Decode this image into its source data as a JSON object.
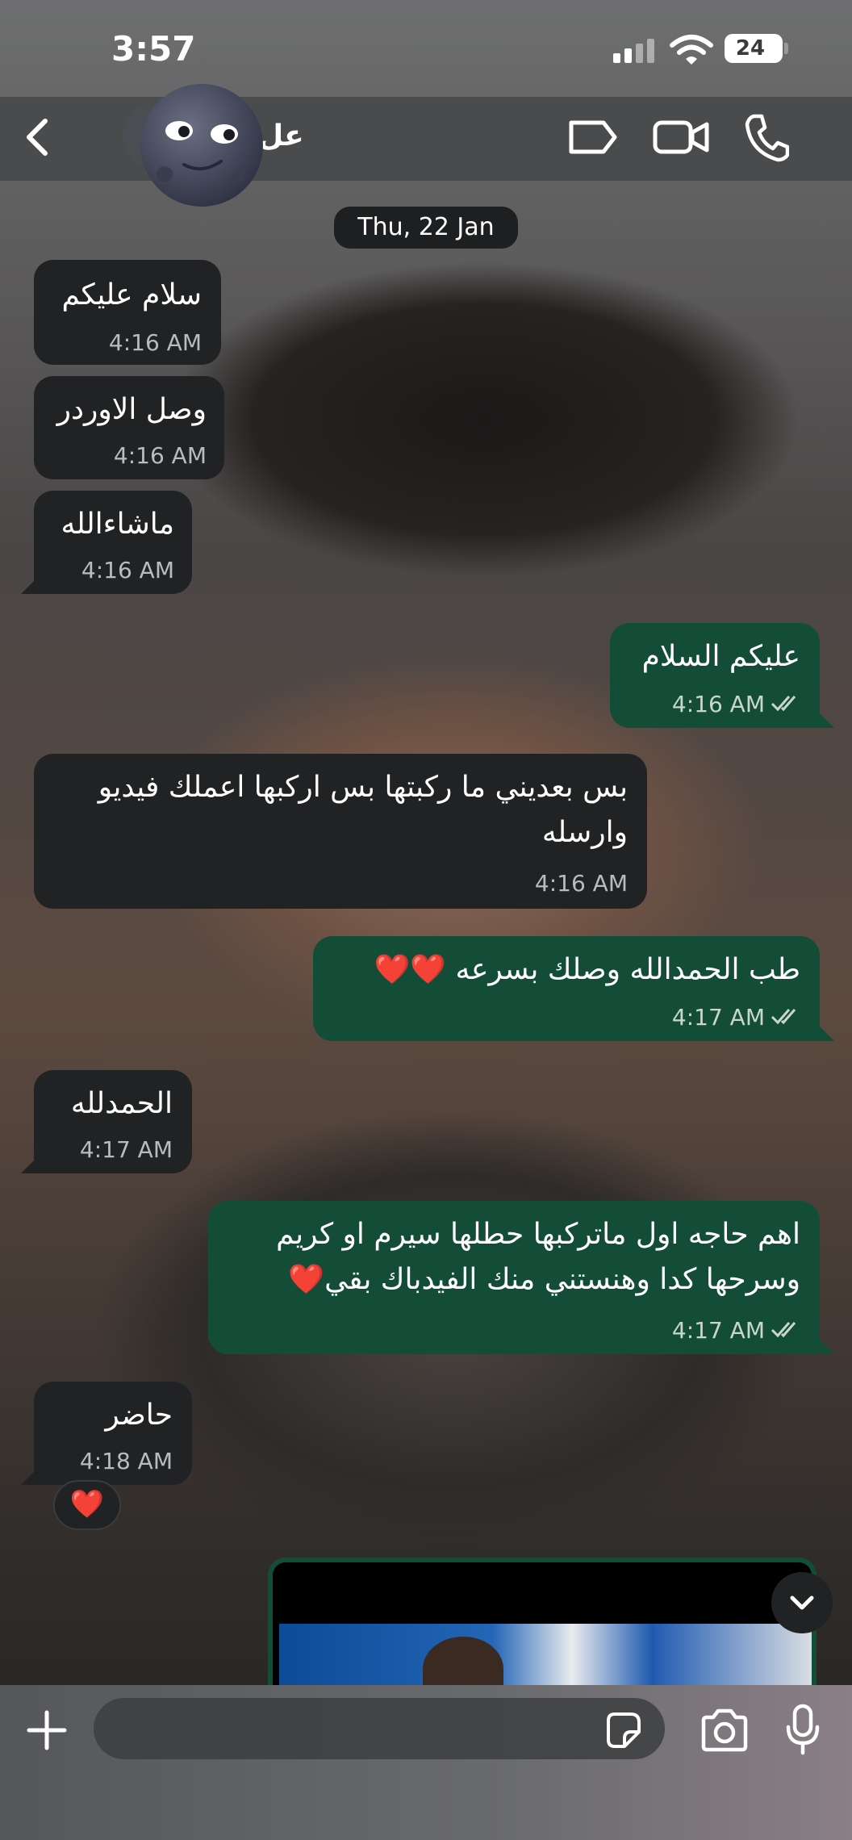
{
  "status_bar": {
    "time": "3:57",
    "battery": "24"
  },
  "header": {
    "contact_name": "عل",
    "avatar_emoji": "new-moon-face",
    "icons": [
      "back-chevron-icon",
      "label-icon",
      "video-camera-icon",
      "phone-icon"
    ]
  },
  "chat": {
    "date_label": "Thu, 22 Jan",
    "messages": [
      {
        "direction": "in",
        "text": "سلام عليكم",
        "time": "4:16 AM"
      },
      {
        "direction": "in",
        "text": "وصل الاوردر",
        "time": "4:16 AM"
      },
      {
        "direction": "in",
        "text": "ماشاءالله",
        "time": "4:16 AM"
      },
      {
        "direction": "out",
        "text": "عليكم السلام",
        "time": "4:16 AM",
        "status": "read"
      },
      {
        "direction": "in",
        "text_lines": [
          "بس بعديني ما ركبتها بس اركبها اعملك فيديو",
          "وارسله"
        ],
        "time": "4:16 AM"
      },
      {
        "direction": "out",
        "text": "طب الحمدالله وصلك بسرعه ❤️❤️",
        "time": "4:17 AM",
        "status": "read"
      },
      {
        "direction": "in",
        "text": "الحمدلله",
        "time": "4:17 AM"
      },
      {
        "direction": "out",
        "text_lines": [
          "اهم حاجه اول ماتركبها حطلها سيرم او كريم",
          "وسرحها كدا وهنستني منك الفيدباك بقي❤️"
        ],
        "time": "4:17 AM",
        "status": "read"
      },
      {
        "direction": "in",
        "text": "حاضر",
        "time": "4:18 AM",
        "reaction": "❤️"
      }
    ]
  },
  "composer": {
    "input_value": "",
    "icons": [
      "plus-icon",
      "sticker-icon",
      "camera-icon",
      "microphone-icon"
    ]
  },
  "colors": {
    "incoming_bubble": "#202223",
    "outgoing_bubble": "#144d37",
    "header": "#46484a"
  }
}
